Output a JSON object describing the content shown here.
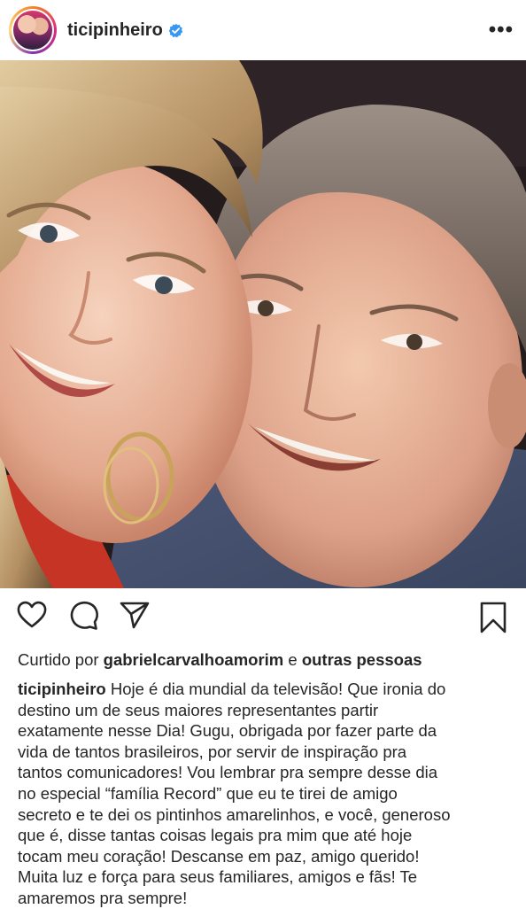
{
  "post": {
    "username": "ticipinheiro",
    "verified_icon": "verified-badge-icon",
    "more_icon": "more-options-icon",
    "more_label": "•••"
  },
  "actions": {
    "like_icon": "heart-icon",
    "comment_icon": "comment-icon",
    "share_icon": "paper-plane-icon",
    "save_icon": "bookmark-icon"
  },
  "likes": {
    "prefix": "Curtido por",
    "user": "gabrielcarvalhoamorim",
    "joiner": "e",
    "others": "outras pessoas"
  },
  "caption": {
    "username": "ticipinheiro",
    "text": " Hoje é dia mundial da televisão! Que ironia do\ndestino um de seus maiores representantes partir\nexatamente nesse Dia! Gugu, obrigada por fazer parte da\nvida de tantos brasileiros, por servir de inspiração pra\ntantos comunicadores! Vou lembrar pra sempre desse dia\nno especial “família Record” que eu te tirei de amigo\nsecreto e te dei os pintinhos amarelinhos, e você, generoso\nque é, disse tantas coisas legais pra mim que até hoje\ntocam meu coração! Descanse em paz, amigo querido!\nMuita luz e força para seus familiares, amigos e fãs! Te\namaremos pra sempre!"
  },
  "colors": {
    "text": "#262626",
    "verified_blue": "#3897f0"
  }
}
